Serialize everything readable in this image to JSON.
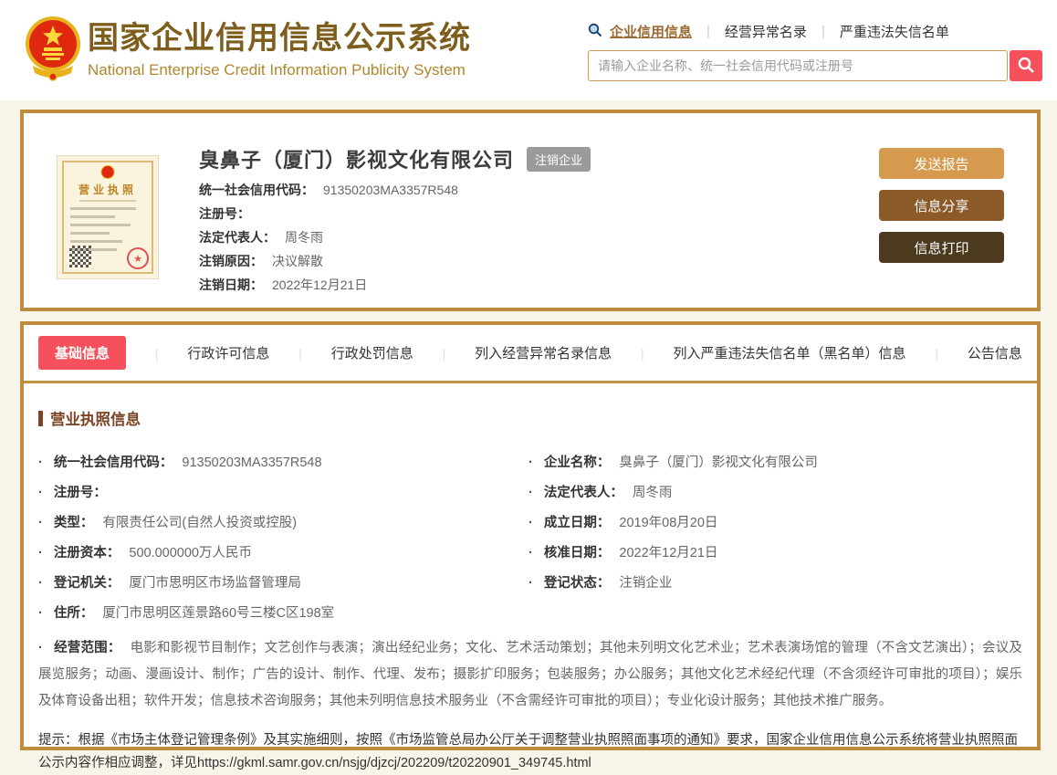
{
  "header": {
    "site_title": "国家企业信用信息公示系统",
    "site_subtitle": "National Enterprise Credit Information Publicity System",
    "nav": {
      "items": [
        {
          "label": "企业信用信息"
        },
        {
          "label": "经营异常名录"
        },
        {
          "label": "严重违法失信名单"
        }
      ]
    },
    "search": {
      "placeholder": "请输入企业名称、统一社会信用代码或注册号",
      "value": ""
    }
  },
  "company_card": {
    "license_thumb_title": "营业执照",
    "name": "臭鼻子（厦门）影视文化有限公司",
    "status_badge": "注销企业",
    "fields": [
      {
        "label": "统一社会信用代码：",
        "value": "91350203MA3357R548"
      },
      {
        "label": "注册号：",
        "value": ""
      },
      {
        "label": "法定代表人：",
        "value": "周冬雨"
      },
      {
        "label": "注销原因：",
        "value": "决议解散"
      },
      {
        "label": "注销日期：",
        "value": "2022年12月21日"
      }
    ],
    "buttons": [
      {
        "label": "发送报告"
      },
      {
        "label": "信息分享"
      },
      {
        "label": "信息打印"
      }
    ]
  },
  "tabs": [
    {
      "label": "基础信息",
      "active": true
    },
    {
      "label": "行政许可信息",
      "active": false
    },
    {
      "label": "行政处罚信息",
      "active": false
    },
    {
      "label": "列入经营异常名录信息",
      "active": false
    },
    {
      "label": "列入严重违法失信名单（黑名单）信息",
      "active": false
    },
    {
      "label": "公告信息",
      "active": false
    }
  ],
  "detail": {
    "section_title": "营业执照信息",
    "left_fields": [
      {
        "label": "统一社会信用代码：",
        "value": "91350203MA3357R548"
      },
      {
        "label": "注册号：",
        "value": ""
      },
      {
        "label": "类型：",
        "value": "有限责任公司(自然人投资或控股)"
      },
      {
        "label": "注册资本：",
        "value": "500.000000万人民币"
      },
      {
        "label": "登记机关：",
        "value": "厦门市思明区市场监督管理局"
      },
      {
        "label": "住所：",
        "value": "厦门市思明区莲景路60号三楼C区198室"
      }
    ],
    "right_fields": [
      {
        "label": "企业名称：",
        "value": "臭鼻子（厦门）影视文化有限公司"
      },
      {
        "label": "法定代表人：",
        "value": "周冬雨"
      },
      {
        "label": "成立日期：",
        "value": "2019年08月20日"
      },
      {
        "label": "核准日期：",
        "value": "2022年12月21日"
      },
      {
        "label": "登记状态：",
        "value": "注销企业"
      }
    ],
    "scope_field": {
      "label": "经营范围：",
      "value": "电影和影视节目制作；文艺创作与表演；演出经纪业务；文化、艺术活动策划；其他未列明文化艺术业；艺术表演场馆的管理（不含文艺演出）；会议及展览服务；动画、漫画设计、制作；广告的设计、制作、代理、发布；摄影扩印服务；包装服务；办公服务；其他文化艺术经纪代理（不含须经许可审批的项目）；娱乐及体育设备出租；软件开发；信息技术咨询服务；其他未列明信息技术服务业（不含需经许可审批的项目）；专业化设计服务；其他技术推广服务。"
    },
    "note": "提示：根据《市场主体登记管理条例》及其实施细则，按照《市场监管总局办公厅关于调整营业执照照面事项的通知》要求，国家企业信用信息公示系统将营业执照照面公示内容作相应调整，详见https://gkml.samr.gov.cn/nsjg/djzcj/202209/t20220901_349745.html"
  },
  "colors": {
    "accent_red": "#f4515c",
    "gold_border": "#bf8c3e",
    "title_brown": "#7d5e1c",
    "subtitle_gold": "#b0872c",
    "nav_link_brown": "#9a6a32",
    "badge_grey": "#9b9b9b",
    "btn_send": "#d69a4e",
    "btn_share": "#8a5a28",
    "btn_print": "#4c3a1e",
    "section_brown": "#7b4526"
  }
}
